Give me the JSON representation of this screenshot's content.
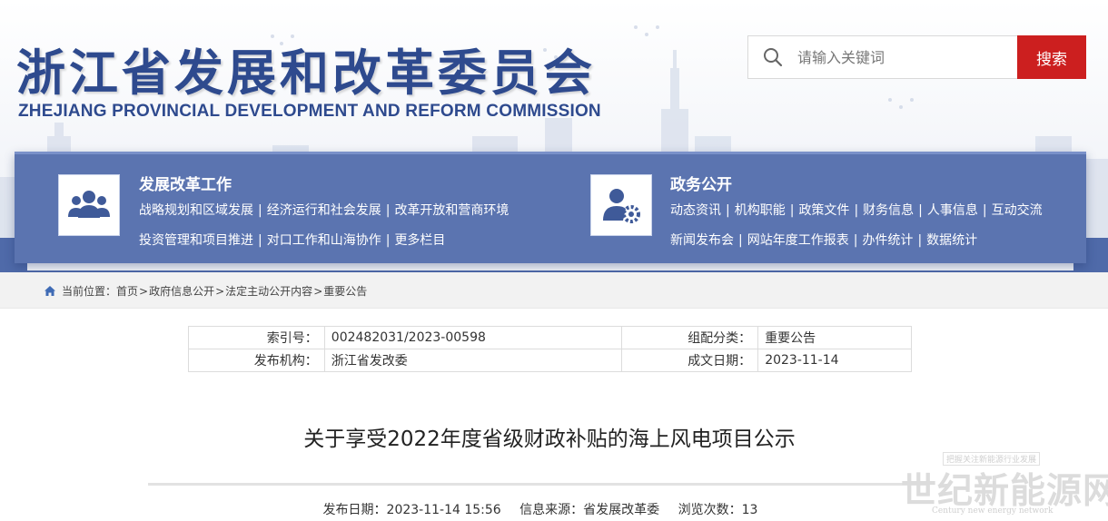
{
  "header": {
    "title_cn": "浙江省发展和改革委员会",
    "title_en": "ZHEJIANG PROVINCIAL DEVELOPMENT AND REFORM COMMISSION",
    "brand_color": "#2e4a8e"
  },
  "search": {
    "placeholder": "请输入关键词",
    "button_label": "搜索",
    "button_color": "#cc1f1f",
    "icon": "search-icon"
  },
  "nav": {
    "panel_color": "#5b74b0",
    "groups": [
      {
        "icon": "people-icon",
        "heading": "发展改革工作",
        "lines": [
          [
            "战略规划和区域发展",
            "经济运行和社会发展",
            "改革开放和营商环境"
          ],
          [
            "投资管理和项目推进",
            "对口工作和山海协作",
            "更多栏目"
          ]
        ]
      },
      {
        "icon": "user-gear-icon",
        "heading": "政务公开",
        "lines": [
          [
            "动态资讯",
            "机构职能",
            "政策文件",
            "财务信息",
            "人事信息",
            "互动交流"
          ],
          [
            "新闻发布会",
            "网站年度工作报表",
            "办件统计",
            "数据统计"
          ]
        ]
      }
    ]
  },
  "breadcrumb": {
    "icon": "home-icon",
    "prefix": "当前位置：",
    "items": [
      "首页",
      "政府信息公开",
      "法定主动公开内容",
      "重要公告"
    ]
  },
  "info": {
    "index_label": "索引号：",
    "index_value": "002482031/2023-00598",
    "category_label": "组配分类：",
    "category_value": "重要公告",
    "publisher_label": "发布机构：",
    "publisher_value": "浙江省发改委",
    "date_label": "成文日期：",
    "date_value": "2023-11-14"
  },
  "article": {
    "title": "关于享受2022年度省级财政补贴的海上风电项目公示",
    "publish_date": "发布日期：2023-11-14 15:56",
    "source": "信息来源：省发展改革委",
    "views": "浏览次数：13"
  },
  "watermark": {
    "top": "把握关注新能源行业发展",
    "main": "世纪新能源网",
    "en": "Century new energy network"
  }
}
